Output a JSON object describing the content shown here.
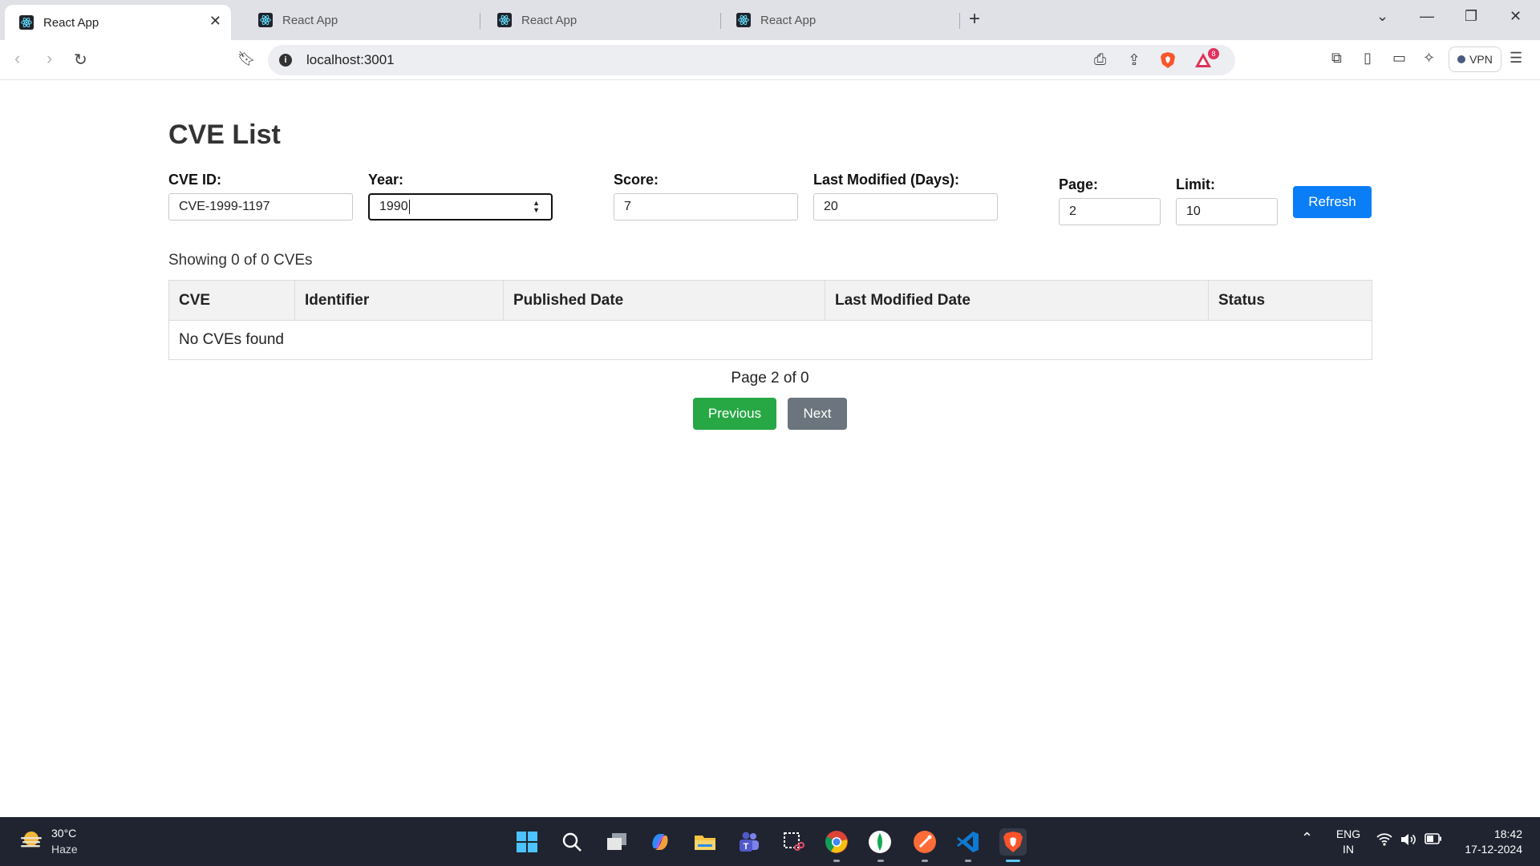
{
  "browser": {
    "tabs": [
      {
        "title": "React App"
      },
      {
        "title": "React App"
      },
      {
        "title": "React App"
      },
      {
        "title": "React App"
      }
    ],
    "url": "localhost:3001",
    "vpn_label": "VPN",
    "notification_count": "8"
  },
  "page": {
    "title": "CVE List",
    "filters": {
      "cve_id": {
        "label": "CVE ID:",
        "value": "CVE-1999-1197"
      },
      "year": {
        "label": "Year:",
        "value": "1990"
      },
      "score": {
        "label": "Score:",
        "value": "7"
      },
      "last_modified": {
        "label": "Last Modified (Days):",
        "value": "20"
      },
      "page": {
        "label": "Page:",
        "value": "2"
      },
      "limit": {
        "label": "Limit:",
        "value": "10"
      }
    },
    "refresh_label": "Refresh",
    "showing_text": "Showing 0 of 0 CVEs",
    "table": {
      "headers": [
        "CVE",
        "Identifier",
        "Published Date",
        "Last Modified Date",
        "Status"
      ],
      "empty_message": "No CVEs found"
    },
    "pagination": {
      "info": "Page 2 of 0",
      "previous_label": "Previous",
      "next_label": "Next"
    }
  },
  "taskbar": {
    "weather": {
      "temp": "30°C",
      "condition": "Haze"
    },
    "language": {
      "line1": "ENG",
      "line2": "IN"
    },
    "time": "18:42",
    "date": "17-12-2024",
    "apps": [
      "start-icon",
      "search-icon",
      "task-view-icon",
      "copilot-icon",
      "file-explorer-icon",
      "teams-icon",
      "snipping-tool-icon",
      "chrome-icon",
      "mongodb-compass-icon",
      "postman-icon",
      "vscode-icon",
      "brave-icon"
    ]
  },
  "colors": {
    "primary": "#0a7ef6",
    "success": "#28a745",
    "secondary": "#6c757d",
    "taskbar": "#1f2430"
  }
}
